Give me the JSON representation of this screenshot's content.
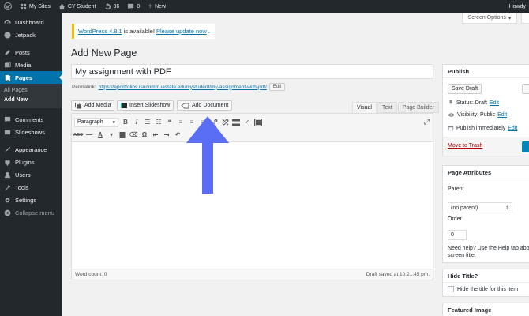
{
  "admin_bar": {
    "my_sites": "My Sites",
    "site_name": "CY Student",
    "updates_count": "36",
    "comments_count": "0",
    "new_label": "New",
    "howdy": "Howdy"
  },
  "sidebar": {
    "items": [
      {
        "label": "Dashboard",
        "icon": "dashboard-icon"
      },
      {
        "label": "Jetpack",
        "icon": "jetpack-icon"
      },
      {
        "label": "Posts",
        "icon": "posts-icon"
      },
      {
        "label": "Media",
        "icon": "media-icon"
      },
      {
        "label": "Pages",
        "icon": "pages-icon"
      },
      {
        "label": "Comments",
        "icon": "comments-icon"
      },
      {
        "label": "Slideshows",
        "icon": "slideshows-icon"
      },
      {
        "label": "Appearance",
        "icon": "appearance-icon"
      },
      {
        "label": "Plugins",
        "icon": "plugins-icon"
      },
      {
        "label": "Users",
        "icon": "users-icon"
      },
      {
        "label": "Tools",
        "icon": "tools-icon"
      },
      {
        "label": "Settings",
        "icon": "settings-icon"
      }
    ],
    "submenu": [
      "All Pages",
      "Add New"
    ],
    "collapse_label": "Collapse menu"
  },
  "screen_options": "Screen Options",
  "notice": {
    "version_link": "WordPress 4.8.1",
    "middle_text": "is available!",
    "update_link": "Please update now",
    "end": "."
  },
  "page_title": "Add New Page",
  "title_value": "My assignment with PDF",
  "permalink": {
    "label": "Permalink:",
    "url": "https://eportfolios.isucomm.iastate.edu/cystudent/my-assignment-with-pdf/",
    "edit": "Edit"
  },
  "media_buttons": {
    "add_media": "Add Media",
    "insert_slideshow": "Insert Slideshow",
    "add_document": "Add Document"
  },
  "editor_tabs": [
    "Visual",
    "Text",
    "Page Builder"
  ],
  "toolbar": {
    "format_value": "Paragraph",
    "row2_abc": "ABC"
  },
  "editor_status": {
    "word_count": "Word count: 0",
    "draft_saved": "Draft saved at 10:21:45 pm."
  },
  "publish": {
    "title": "Publish",
    "save_draft": "Save Draft",
    "status_label": "Status: Draft",
    "visibility_label": "Visibility: Public",
    "publish_immediately": "Publish immediately",
    "edit": "Edit",
    "move_to_trash": "Move to Trash"
  },
  "page_attributes": {
    "title": "Page Attributes",
    "parent_label": "Parent",
    "parent_value": "(no parent)",
    "order_label": "Order",
    "order_value": "0",
    "help_text": "Need help? Use the Help tab abov screen title."
  },
  "hide_title": {
    "title": "Hide Title?",
    "checkbox_label": "Hide the title for this item"
  },
  "featured_image": {
    "title": "Featured Image"
  },
  "colors": {
    "admin_dark": "#23282d",
    "accent_blue": "#0073aa",
    "arrow_blue": "#5a6ef5",
    "trash_red": "#a00000",
    "notice_yellow": "#ffb900"
  }
}
